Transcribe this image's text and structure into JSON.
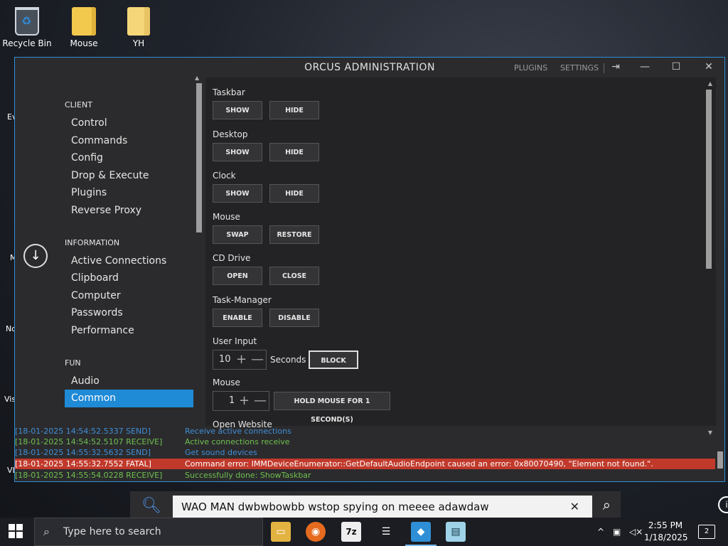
{
  "desktop": {
    "icons": [
      {
        "label": "Recycle Bin"
      },
      {
        "label": "Mouse"
      },
      {
        "label": "YH"
      }
    ],
    "side_labels": [
      "Ev",
      "M",
      "No",
      "Vis",
      "VL"
    ]
  },
  "window": {
    "title": "ORCUS ADMINISTRATION",
    "links": {
      "plugins": "PLUGINS",
      "settings": "SETTINGS"
    },
    "controls": {
      "minimize": "—",
      "maximize": "☐",
      "close": "✕",
      "logout": "⇥"
    }
  },
  "nav": {
    "client_header": "CLIENT",
    "client_items": [
      "Control",
      "Commands",
      "Config",
      "Drop & Execute",
      "Plugins",
      "Reverse Proxy"
    ],
    "information_header": "INFORMATION",
    "information_items": [
      "Active Connections",
      "Clipboard",
      "Computer",
      "Passwords",
      "Performance"
    ],
    "fun_header": "FUN",
    "fun_items": [
      "Audio",
      "Common"
    ],
    "active_item": "Common"
  },
  "content": {
    "taskbar": {
      "label": "Taskbar",
      "show": "SHOW",
      "hide": "HIDE"
    },
    "desktop": {
      "label": "Desktop",
      "show": "SHOW",
      "hide": "HIDE"
    },
    "clock": {
      "label": "Clock",
      "show": "SHOW",
      "hide": "HIDE"
    },
    "mouse": {
      "label": "Mouse",
      "swap": "SWAP",
      "restore": "RESTORE"
    },
    "cd_drive": {
      "label": "CD Drive",
      "open": "OPEN",
      "close": "CLOSE"
    },
    "task_manager": {
      "label": "Task-Manager",
      "enable": "ENABLE",
      "disable": "DISABLE"
    },
    "user_input": {
      "label": "User Input",
      "value": "10",
      "unit": "Seconds",
      "block": "BLOCK"
    },
    "mouse_hold": {
      "label": "Mouse",
      "value": "1",
      "button": "HOLD MOUSE FOR 1 SECOND(S)"
    },
    "open_website": {
      "label": "Open Website"
    }
  },
  "log": [
    {
      "ts": "[18-01-2025 14:54:52.5337 SEND]",
      "msg": "Receive active connections",
      "kind": "send"
    },
    {
      "ts": "[18-01-2025 14:54:52.5107 RECEIVE]",
      "msg": "Active connections receive",
      "kind": "recv"
    },
    {
      "ts": "[18-01-2025 14:55:32.5632 SEND]",
      "msg": "Get sound devices",
      "kind": "send"
    },
    {
      "ts": "[18-01-2025 14:55:32.7552 FATAL]",
      "msg": "Command error: IMMDeviceEnumerator::GetDefaultAudioEndpoint caused an error: 0x80070490, \"Element not found.\".",
      "kind": "fatal"
    },
    {
      "ts": "[18-01-2025 14:55:54.0228 RECEIVE]",
      "msg": "Successfully done: ShowTaskbar",
      "kind": "recv"
    }
  ],
  "search_popup": {
    "query": "WAO MAN dwbwbowbb wstop spying on meeee adawdaw"
  },
  "taskbar": {
    "search_placeholder": "Type here to search",
    "apps": [
      "File Explorer",
      "Firefox",
      "7-Zip",
      "Tool",
      "Orcus",
      "Notepad"
    ],
    "time": "2:55 PM",
    "date": "1/18/2025",
    "notifications": "2"
  }
}
